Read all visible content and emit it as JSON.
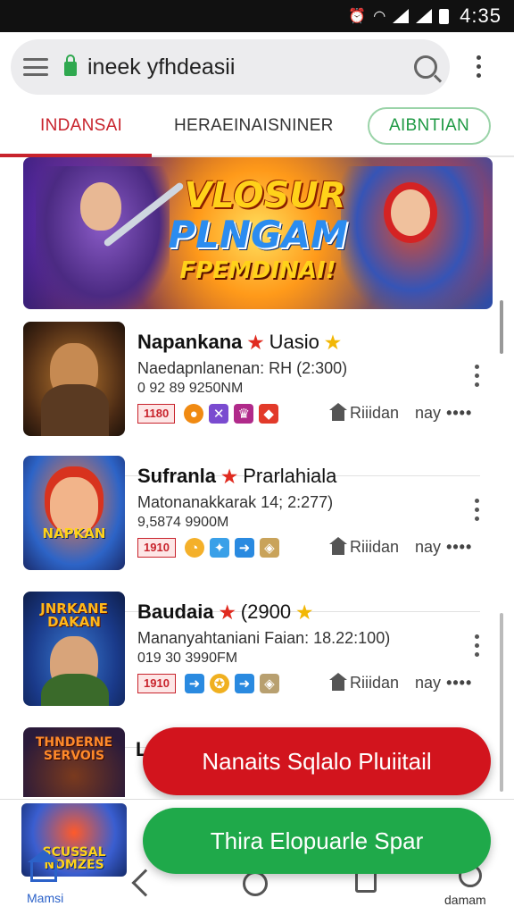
{
  "status_bar": {
    "time": "4:35",
    "alarm_icon": "alarm-icon",
    "wifi_icon": "wifi-icon",
    "battery_icon": "battery-icon"
  },
  "browser": {
    "url": "ineek yfhdeasii",
    "menu_icon": "hamburger-icon",
    "search_icon": "search-icon",
    "more_icon": "more-vert-icon"
  },
  "tabs": [
    {
      "label": "INDANSAI"
    },
    {
      "label": "HERAEINAISNINER"
    },
    {
      "label": "AIBNTIAN"
    }
  ],
  "banner": {
    "line1": "VLOSUR",
    "line2": "PLNGAM",
    "line3": "FPEMDINAI!"
  },
  "apps": [
    {
      "title": "Napankana",
      "title_rest": "Uasio",
      "subtitle": "Naedapnlanenan: RH (2:300)",
      "meta": "0 92 89 9250NM",
      "badge": "1180",
      "location": "Riiidan",
      "time": "nay",
      "dots": "••••"
    },
    {
      "title": "Sufranla",
      "title_rest": "Prarlahiala",
      "subtitle": "Matonanakkarak 14; 2:277)",
      "meta": "9,5874 9900M",
      "badge": "1910",
      "location": "Riiidan",
      "time": "nay",
      "dots": "••••",
      "thumb_text": "NAPKAN"
    },
    {
      "title": "Baudaia",
      "title_rest": "(2900",
      "subtitle": "Mananyahtaniani Faian: 18.22:100)",
      "meta": "019 30 3990FM",
      "badge": "1910",
      "location": "Riiidan",
      "time": "nay",
      "dots": "••••",
      "thumb_text": "JNRKANE DAKAN"
    }
  ],
  "peek": {
    "thumb_text": "THNDERNE SERVOIS",
    "letter": "L"
  },
  "buttons": {
    "primary_red": "Nanaits Sqlalo Pluiitail",
    "primary_green": "Thira Elopuarle Spar"
  },
  "bottom_nav": {
    "thumb_text": "SCUSSAL NOMZES",
    "home_label": "Mamsi",
    "profile_label": "damam"
  },
  "colors": {
    "accent_red": "#d2141d",
    "accent_green": "#1fa94a",
    "link_blue": "#2c62c9"
  }
}
